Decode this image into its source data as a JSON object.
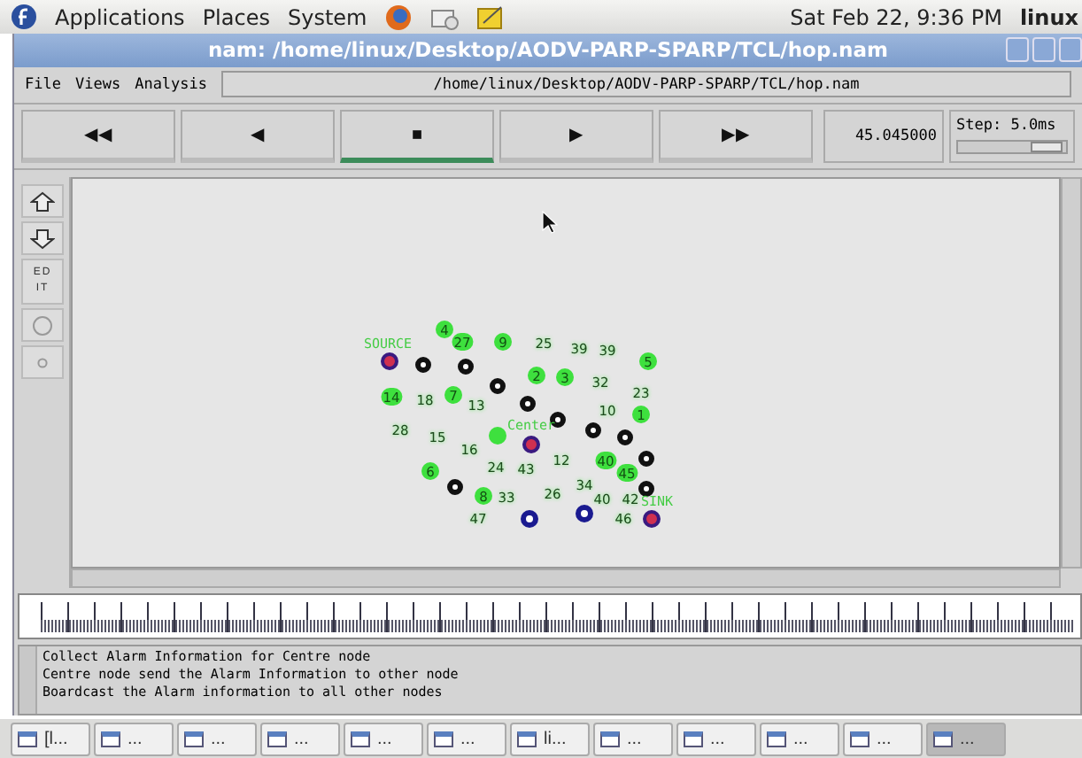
{
  "top_panel": {
    "menus": [
      "Applications",
      "Places",
      "System"
    ],
    "clock": "Sat Feb 22,  9:36 PM",
    "user": "linux"
  },
  "window": {
    "title": "nam: /home/linux/Desktop/AODV-PARP-SPARP/TCL/hop.nam"
  },
  "menu": {
    "items": [
      "File",
      "Views",
      "Analysis"
    ],
    "path": "/home/linux/Desktop/AODV-PARP-SPARP/TCL/hop.nam"
  },
  "controls": {
    "buttons": [
      {
        "label": "◀◀",
        "selected": false
      },
      {
        "label": "◀",
        "selected": false
      },
      {
        "label": "■",
        "selected": true
      },
      {
        "label": "▶",
        "selected": false
      },
      {
        "label": "▶▶",
        "selected": false
      }
    ],
    "time": "45.045000",
    "step": "Step: 5.0ms",
    "step_slider": {
      "level": 0.82
    }
  },
  "tools": [
    {
      "kind": "up"
    },
    {
      "kind": "down"
    },
    {
      "kind": "edit",
      "label": "ED IT"
    },
    {
      "kind": "circle"
    },
    {
      "kind": "dot"
    }
  ],
  "nodes": [
    {
      "kind": "green",
      "label": "4"
    },
    {
      "kind": "green",
      "label": "27"
    },
    {
      "kind": "green",
      "label": "9"
    },
    {
      "kind": "text",
      "label": "25"
    },
    {
      "kind": "text",
      "label": "39"
    },
    {
      "kind": "text",
      "label": "39"
    },
    {
      "kind": "green",
      "label": "5"
    },
    {
      "kind": "tag",
      "label": "SOURCE"
    },
    {
      "kind": "endpoint"
    },
    {
      "kind": "black"
    },
    {
      "kind": "black"
    },
    {
      "kind": "green",
      "label": "2"
    },
    {
      "kind": "green",
      "label": "3"
    },
    {
      "kind": "text",
      "label": "32"
    },
    {
      "kind": "black"
    },
    {
      "kind": "green",
      "label": "14"
    },
    {
      "kind": "text",
      "label": "18"
    },
    {
      "kind": "green",
      "label": "7"
    },
    {
      "kind": "text",
      "label": "13"
    },
    {
      "kind": "black"
    },
    {
      "kind": "text",
      "label": "23"
    },
    {
      "kind": "text",
      "label": "10"
    },
    {
      "kind": "green",
      "label": "1"
    },
    {
      "kind": "black"
    },
    {
      "kind": "black"
    },
    {
      "kind": "black"
    },
    {
      "kind": "text",
      "label": "28"
    },
    {
      "kind": "text",
      "label": "15"
    },
    {
      "kind": "green"
    },
    {
      "kind": "tag",
      "label": "Center"
    },
    {
      "kind": "endpoint"
    },
    {
      "kind": "text",
      "label": "16"
    },
    {
      "kind": "text",
      "label": "12"
    },
    {
      "kind": "green",
      "label": "40"
    },
    {
      "kind": "black"
    },
    {
      "kind": "green",
      "label": "6"
    },
    {
      "kind": "text",
      "label": "24"
    },
    {
      "kind": "text",
      "label": "43"
    },
    {
      "kind": "green",
      "label": "45"
    },
    {
      "kind": "black"
    },
    {
      "kind": "text",
      "label": "34"
    },
    {
      "kind": "black"
    },
    {
      "kind": "green",
      "label": "8"
    },
    {
      "kind": "text",
      "label": "33"
    },
    {
      "kind": "text",
      "label": "26"
    },
    {
      "kind": "text",
      "label": "40"
    },
    {
      "kind": "text",
      "label": "42"
    },
    {
      "kind": "tag",
      "label": "SINK"
    },
    {
      "kind": "endpoint"
    },
    {
      "kind": "text",
      "label": "47"
    },
    {
      "kind": "blue"
    },
    {
      "kind": "blue"
    },
    {
      "kind": "text",
      "label": "46"
    }
  ],
  "messages": [
    "Collect Alarm Information for Centre node",
    "Centre node send the Alarm Information to other node",
    "Boardcast the Alarm information to all other nodes"
  ],
  "taskbar": [
    {
      "label": "[l...",
      "selected": false
    },
    {
      "label": "...",
      "selected": false
    },
    {
      "label": "...",
      "selected": false
    },
    {
      "label": "...",
      "selected": false
    },
    {
      "label": "...",
      "selected": false
    },
    {
      "label": "...",
      "selected": false
    },
    {
      "label": "li...",
      "selected": false
    },
    {
      "label": "...",
      "selected": false
    },
    {
      "label": "...",
      "selected": false
    },
    {
      "label": "...",
      "selected": false
    },
    {
      "label": "...",
      "selected": false
    },
    {
      "label": "...",
      "selected": true
    }
  ]
}
